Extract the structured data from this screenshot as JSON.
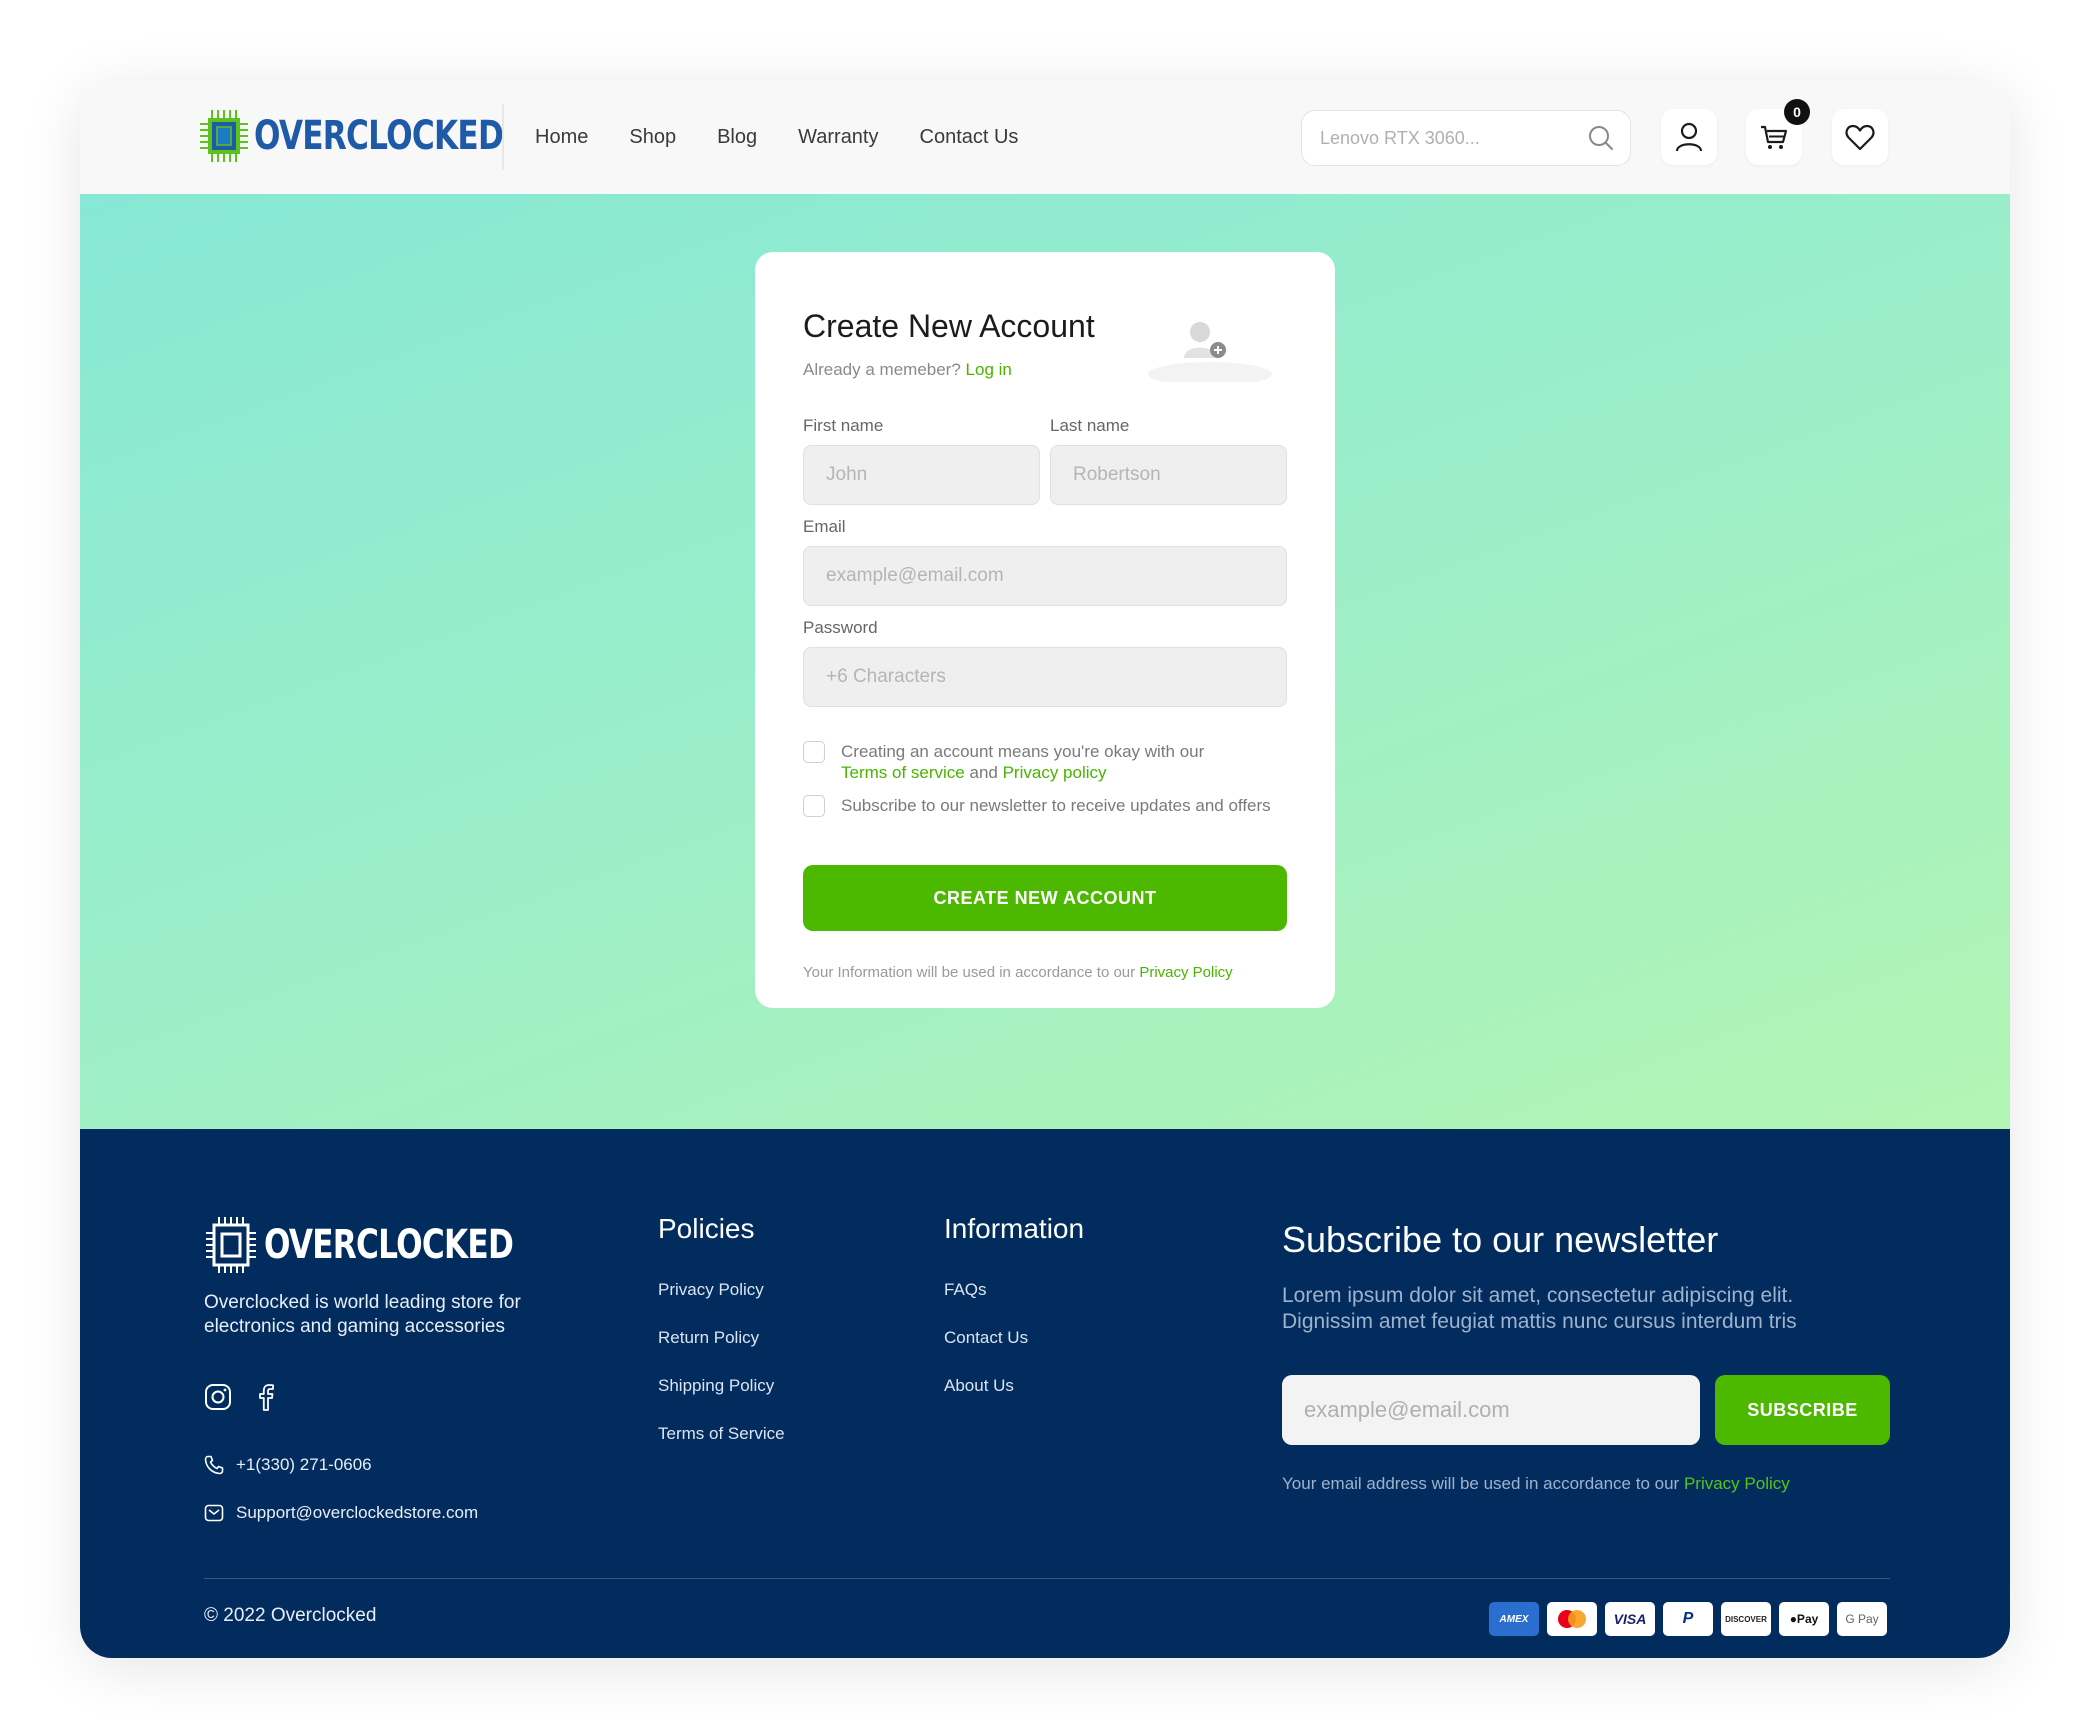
{
  "header": {
    "logo_text": "OVERCLOCKED",
    "nav": [
      "Home",
      "Shop",
      "Blog",
      "Warranty",
      "Contact Us"
    ],
    "search_placeholder": "Lenovo RTX 3060...",
    "cart_count": "0"
  },
  "signup": {
    "title": "Create New Account",
    "member_prompt": "Already a memeber?",
    "login_link": "Log in",
    "first_name_label": "First name",
    "first_name_placeholder": "John",
    "last_name_label": "Last name",
    "last_name_placeholder": "Robertson",
    "email_label": "Email",
    "email_placeholder": "example@email.com",
    "password_label": "Password",
    "password_placeholder": "+6 Characters",
    "terms_text_1": "Creating an account means you're okay with our",
    "terms_link": "Terms of service",
    "terms_and": "and",
    "privacy_link": "Privacy policy",
    "newsletter_text": "Subscribe to our newsletter to receive updates and offers",
    "terms_checked": false,
    "newsletter_checked": false,
    "submit_label": "CREATE NEW ACCOUNT",
    "footnote": "Your Information will be used in accordance to our",
    "footnote_link": "Privacy Policy"
  },
  "footer": {
    "logo_text": "OVERCLOCKED",
    "description": "Overclocked is world leading store for electronics and gaming accessories",
    "phone": "+1(330) 271-0606",
    "email": "Support@overclockedstore.com",
    "policies_heading": "Policies",
    "policies": [
      "Privacy Policy",
      "Return Policy",
      "Shipping Policy",
      "Terms of Service"
    ],
    "information_heading": "Information",
    "information": [
      "FAQs",
      "Contact Us",
      "About Us"
    ],
    "newsletter_heading": "Subscribe to our newsletter",
    "newsletter_text": "Lorem ipsum dolor sit amet, consectetur adipiscing elit. Dignissim amet feugiat mattis nunc cursus interdum tris",
    "newsletter_placeholder": "example@email.com",
    "subscribe_label": "SUBSCRIBE",
    "newsletter_note": "Your email address will be used in accordance to our",
    "newsletter_note_link": "Privacy Policy",
    "copyright": "© 2022 Overclocked",
    "payments": [
      "AMEX",
      "Mastercard",
      "VISA",
      "PayPal",
      "DISCOVER",
      "Apple Pay",
      "G Pay"
    ]
  },
  "colors": {
    "brand_blue": "#1e5aa8",
    "accent_green": "#4cb800",
    "footer_bg": "#022c5e"
  }
}
